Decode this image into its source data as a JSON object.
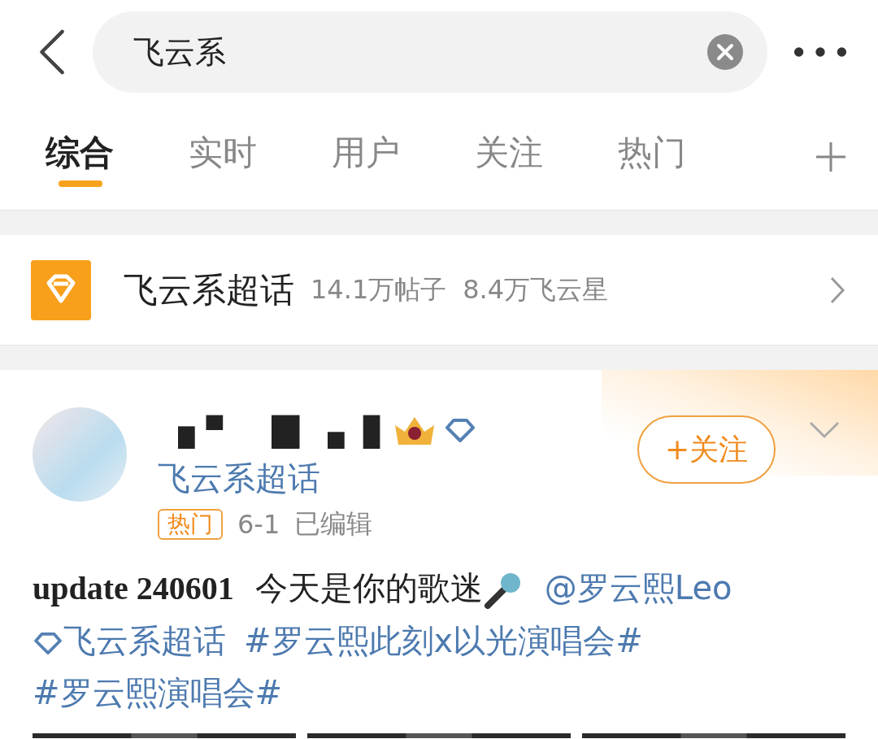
{
  "search": {
    "value": "飞云系"
  },
  "tabs": [
    {
      "label": "综合",
      "selected": true
    },
    {
      "label": "实时",
      "selected": false
    },
    {
      "label": "用户",
      "selected": false
    },
    {
      "label": "关注",
      "selected": false
    },
    {
      "label": "热门",
      "selected": false
    }
  ],
  "supertopic": {
    "name": "飞云系超话",
    "posts": "14.1万帖子",
    "members": "8.4万飞云星"
  },
  "post": {
    "supertopic_link": "飞云系超话",
    "follow": "+关注",
    "tag": "热门",
    "date": "6-1",
    "edited": "已编辑",
    "content": [
      {
        "kind": "bold",
        "text": "update 240601"
      },
      {
        "kind": "text",
        "text": "今天是你的歌迷"
      },
      {
        "kind": "mic"
      },
      {
        "kind": "mention",
        "text": "@罗云熙Leo"
      },
      {
        "kind": "topic",
        "text": "飞云系超话"
      },
      {
        "kind": "hashtag",
        "text": "#罗云熙此刻x以光演唱会#"
      },
      {
        "kind": "hashtag",
        "text": "#罗云熙演唱会#"
      }
    ]
  }
}
